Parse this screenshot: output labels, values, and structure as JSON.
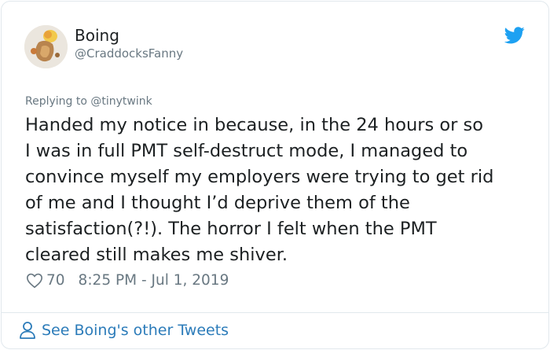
{
  "tweet": {
    "author": {
      "display_name": "Boing",
      "handle": "@CraddocksFanny",
      "avatar_icon": "avatar-image"
    },
    "reply_to": {
      "prefix": "Replying to",
      "handle": "@tinytwink"
    },
    "text": "Handed my notice in because, in the 24 hours or so\nI was in full PMT self-destruct mode, I managed to\nconvince myself my employers were trying to get rid\nof me and I thought I’d deprive them of the\nsatisfaction(?!). The horror I felt when the PMT\ncleared still makes me shiver.",
    "likes": "70",
    "timestamp": "8:25 PM - Jul 1, 2019",
    "footer_link": "See Boing's other Tweets"
  },
  "colors": {
    "twitter_blue": "#1da1f2",
    "link_blue": "#2b7bb9",
    "secondary_text": "#697882",
    "border": "#e1e8ed"
  },
  "icons": [
    "twitter-bird-icon",
    "heart-icon",
    "person-icon"
  ]
}
